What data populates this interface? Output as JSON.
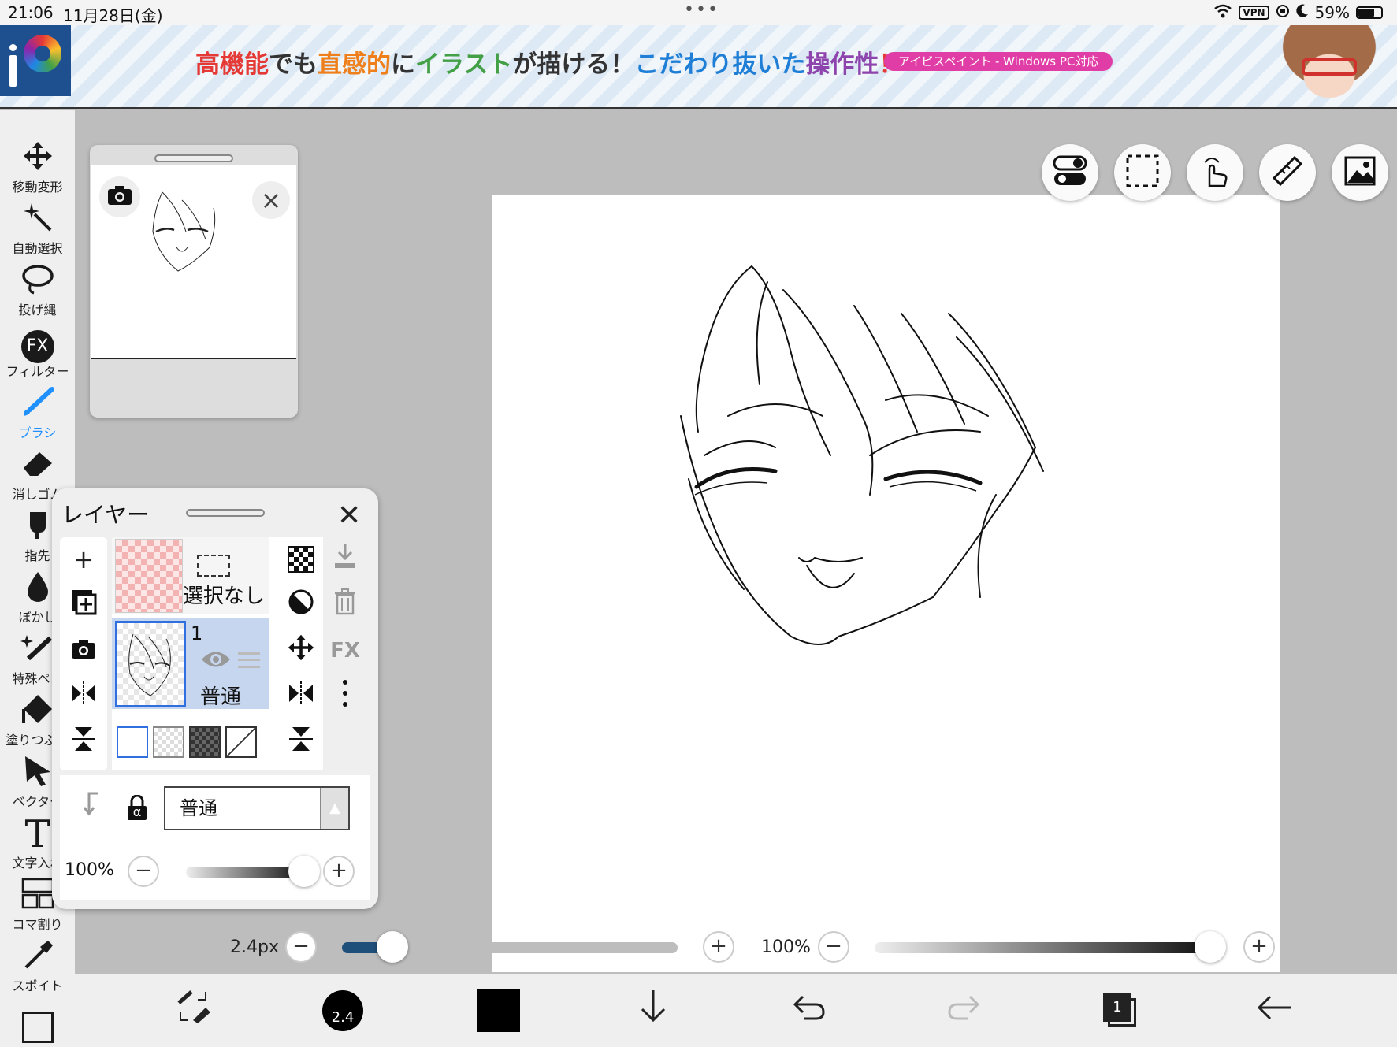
{
  "status_bar": {
    "time": "21:06",
    "date": "11月28日(金)",
    "vpn": "VPN",
    "battery": "59%"
  },
  "banner": {
    "headline_parts": [
      "高機能",
      "でも",
      "直感的",
      "に",
      "イラスト",
      "が描ける！",
      "こだわり抜いた",
      "操作性",
      "！"
    ],
    "pill": "アイビスペイント - Windows PC対応"
  },
  "toolbar": {
    "items": [
      {
        "label": "移動変形",
        "icon": "move-icon"
      },
      {
        "label": "自動選択",
        "icon": "magic-wand-icon"
      },
      {
        "label": "投げ縄",
        "icon": "lasso-icon"
      },
      {
        "label": "フィルター",
        "icon": "fx-icon"
      },
      {
        "label": "ブラシ",
        "icon": "brush-icon"
      },
      {
        "label": "消しゴム",
        "icon": "eraser-icon"
      },
      {
        "label": "指先",
        "icon": "finger-icon"
      },
      {
        "label": "ぼかし",
        "icon": "blur-icon"
      },
      {
        "label": "特殊ペン",
        "icon": "special-pen-icon"
      },
      {
        "label": "塗りつぶし",
        "icon": "fill-icon"
      },
      {
        "label": "ベクター",
        "icon": "vector-icon"
      },
      {
        "label": "文字入れ",
        "icon": "text-icon"
      },
      {
        "label": "コマ割り",
        "icon": "frame-divider-icon"
      },
      {
        "label": "スポイト",
        "icon": "eyedropper-icon"
      }
    ],
    "fx_glyph": "FX",
    "text_glyph": "T"
  },
  "layer_panel": {
    "title": "レイヤー",
    "selection_layer_label": "選択なし",
    "layer_number": "1",
    "layer_mode": "普通",
    "blend_mode": "普通",
    "fx_label": "FX",
    "alpha_lock": "α",
    "opacity_label": "100%",
    "opacity_value": 1.0
  },
  "brush_bar": {
    "size_label": "2.4px",
    "size_value": 0.15,
    "opacity_label": "100%",
    "opacity_value": 1.0
  },
  "bottom_bar": {
    "brush_size_label": "2.4",
    "layer_count": "1",
    "color": "#000000"
  },
  "colors": {
    "accent": "#1e90ff",
    "layer_selected": "#c6d6ef"
  }
}
